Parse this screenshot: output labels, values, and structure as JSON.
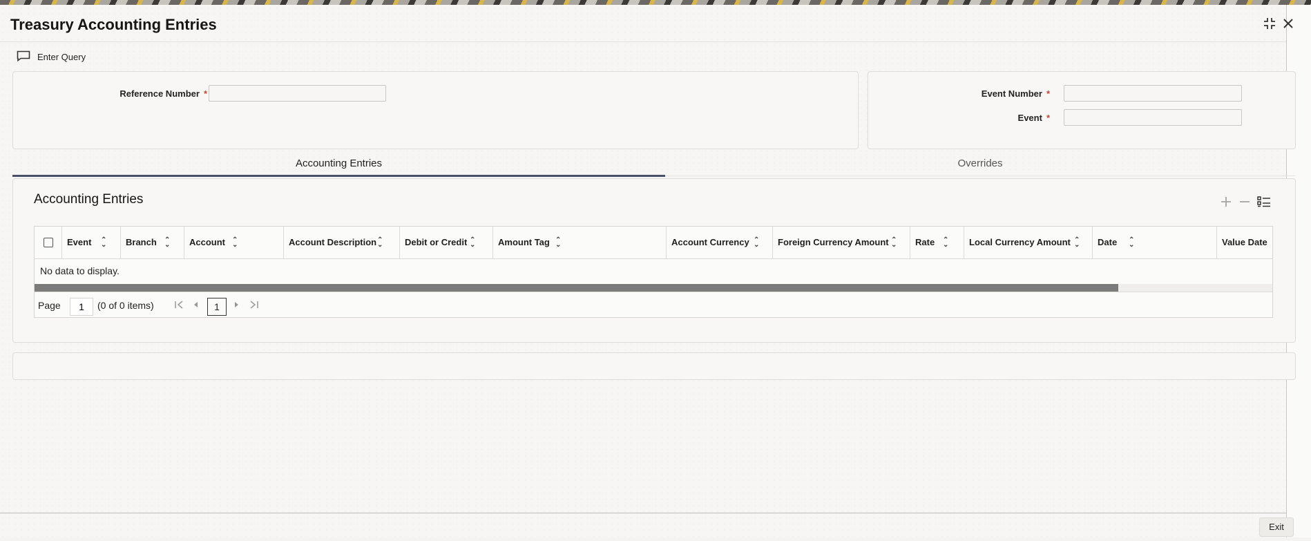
{
  "window": {
    "title": "Treasury Accounting Entries"
  },
  "toolbar": {
    "enter_query_label": "Enter Query"
  },
  "form": {
    "reference_number": {
      "label": "Reference Number",
      "value": ""
    },
    "event_number": {
      "label": "Event Number",
      "value": ""
    },
    "event": {
      "label": "Event",
      "value": ""
    },
    "required_marker": "*"
  },
  "tabs": [
    {
      "label": "Accounting Entries",
      "active": true
    },
    {
      "label": "Overrides",
      "active": false
    }
  ],
  "section": {
    "title": "Accounting Entries"
  },
  "grid": {
    "columns": [
      "Event",
      "Branch",
      "Account",
      "Account Description",
      "Debit or Credit",
      "Amount Tag",
      "Account Currency",
      "Foreign Currency Amount",
      "Rate",
      "Local Currency Amount",
      "Date",
      "Value Date"
    ],
    "empty_message": "No data to display."
  },
  "pagination": {
    "page_label": "Page",
    "page_value": "1",
    "items_text": "(0 of 0 items)",
    "current_page": "1"
  },
  "footer": {
    "exit_label": "Exit"
  },
  "colors": {
    "tab_active": "#48536b",
    "required": "#c74634",
    "scroll_thumb": "#7b7b7b"
  }
}
